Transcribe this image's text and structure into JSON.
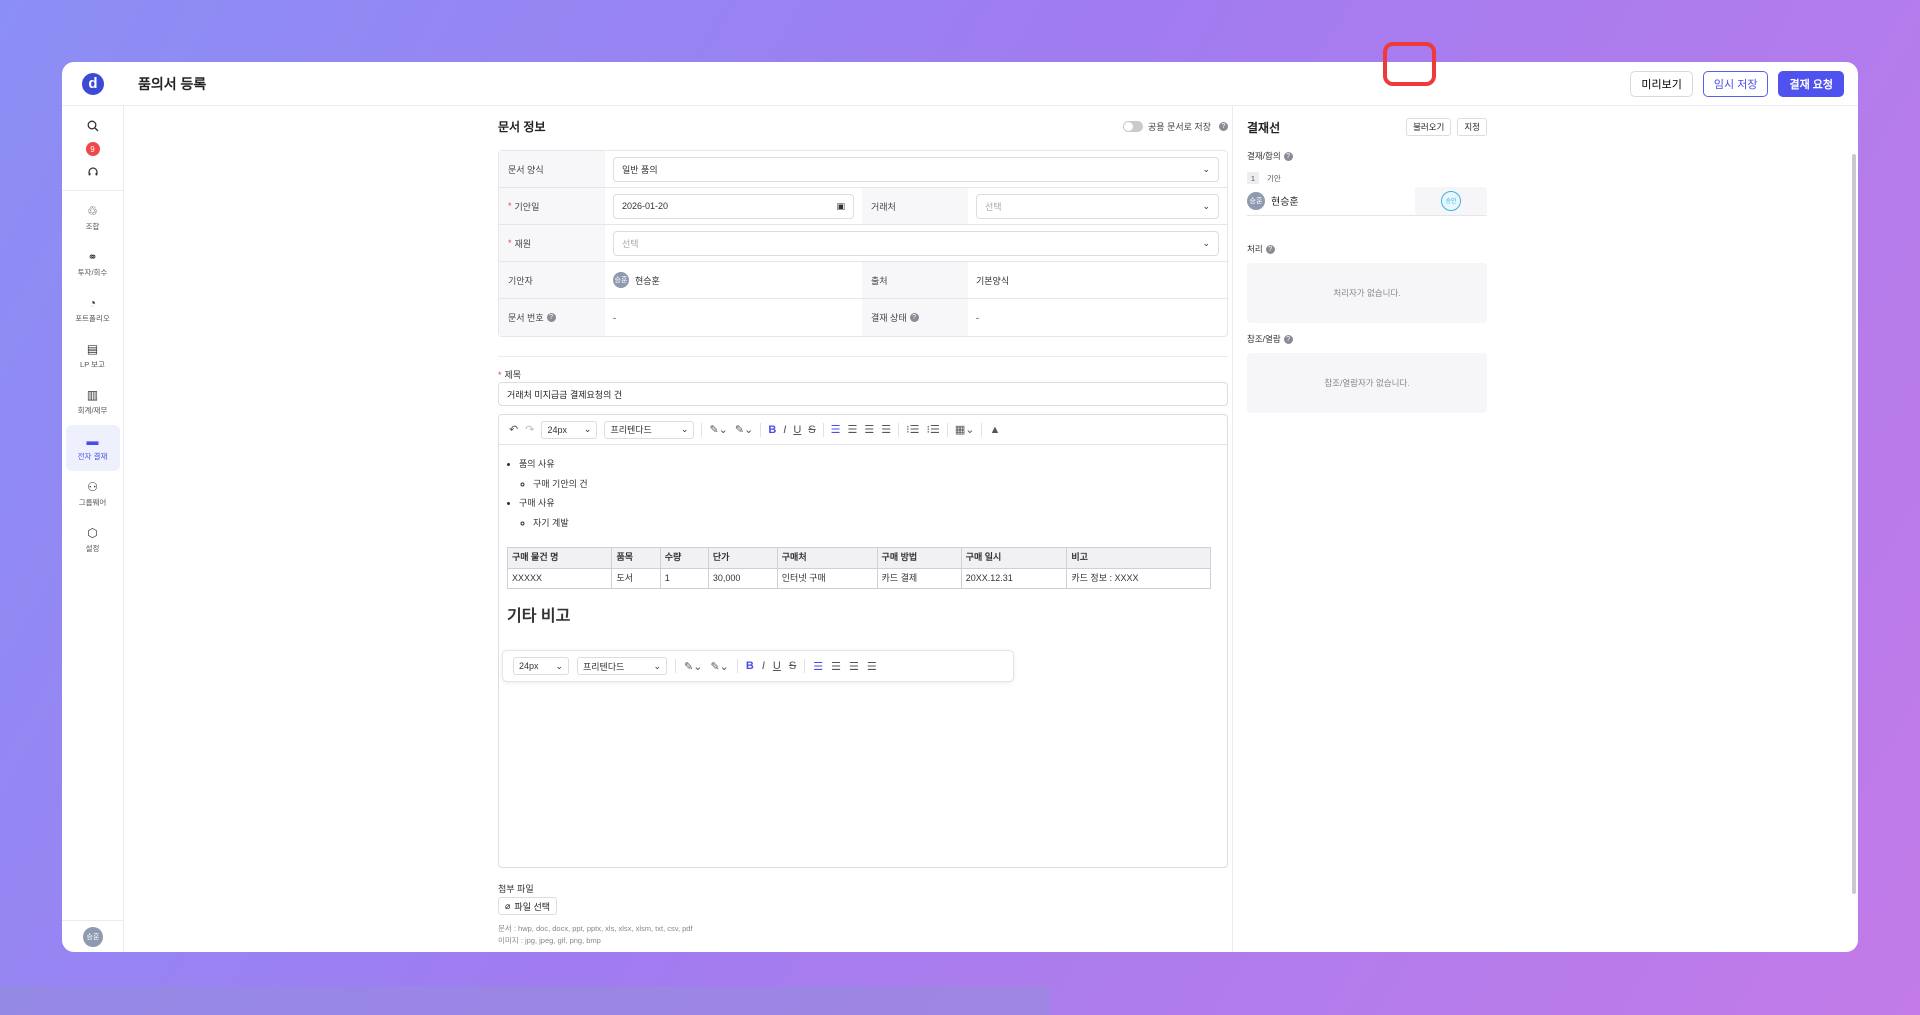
{
  "header": {
    "title": "품의서 등록",
    "logo": "d",
    "preview": "미리보기",
    "temp_save": "임시 저장",
    "submit": "결재 요청"
  },
  "sidebar": {
    "badge": "9",
    "items": [
      {
        "label": "조합",
        "icon": "union-icon"
      },
      {
        "label": "투자/회수",
        "icon": "invest-icon"
      },
      {
        "label": "포트폴리오",
        "icon": "pie-icon"
      },
      {
        "label": "LP 보고",
        "icon": "report-icon"
      },
      {
        "label": "회계/재무",
        "icon": "accounting-icon"
      },
      {
        "label": "전자 결재",
        "icon": "inbox-icon"
      },
      {
        "label": "그룹웨어",
        "icon": "group-icon"
      },
      {
        "label": "설정",
        "icon": "settings-icon"
      }
    ],
    "user_avatar": "승훈"
  },
  "doc_info": {
    "title": "문서 정보",
    "shared_toggle": "공용 문서로 저장",
    "form_label": "문서 양식",
    "form_value": "일반 품의",
    "date_label": "기안일",
    "date_value": "2026-01-20",
    "vendor_label": "거래처",
    "vendor_ph": "선택",
    "finance_label": "재원",
    "finance_ph": "선택",
    "drafter_label": "기안자",
    "drafter_avatar": "승훈",
    "drafter_name": "현승훈",
    "source_label": "출처",
    "source_value": "기본양식",
    "docnum_label": "문서 번호",
    "docnum_value": "-",
    "status_label": "결재 상태",
    "status_value": "-"
  },
  "subject": {
    "label": "제목",
    "value": "거래처 미지급금 결제요청의 건"
  },
  "editor": {
    "font_size": "24px",
    "font_family": "프리텐다드",
    "b1": "품의 사유",
    "b1s": "구매 기안의 건",
    "b2": "구매 사유",
    "b2s": "자기 계발",
    "table": {
      "headers": [
        "구매 물건 명",
        "품목",
        "수량",
        "단가",
        "구매처",
        "구매 방법",
        "구매 일시",
        "비고"
      ],
      "row": [
        "XXXXX",
        "도서",
        "1",
        "30,000",
        "인터넷 구매",
        "카드 결제",
        "20XX.12.31",
        "카드 정보 : XXXX"
      ]
    },
    "heading": "기타 비고"
  },
  "attach": {
    "label": "첨부 파일",
    "button": "파일 선택",
    "hint1": "문서 : hwp, doc, docx, ppt, pptx, xls, xlsx, xlsm, txt, csv, pdf",
    "hint2": "이미지 : jpg, jpeg, gif, png, bmp"
  },
  "approval": {
    "title": "결재선",
    "load": "불러오기",
    "assign": "지정",
    "approve_label": "결재/합의",
    "step_num": "1",
    "step_type": "기안",
    "approver_avatar": "승훈",
    "approver_name": "현승훈",
    "stamp": "승인",
    "process_label": "처리",
    "process_empty": "처리자가 없습니다.",
    "ref_label": "참조/열람",
    "ref_empty": "참조/열람자가 없습니다."
  }
}
